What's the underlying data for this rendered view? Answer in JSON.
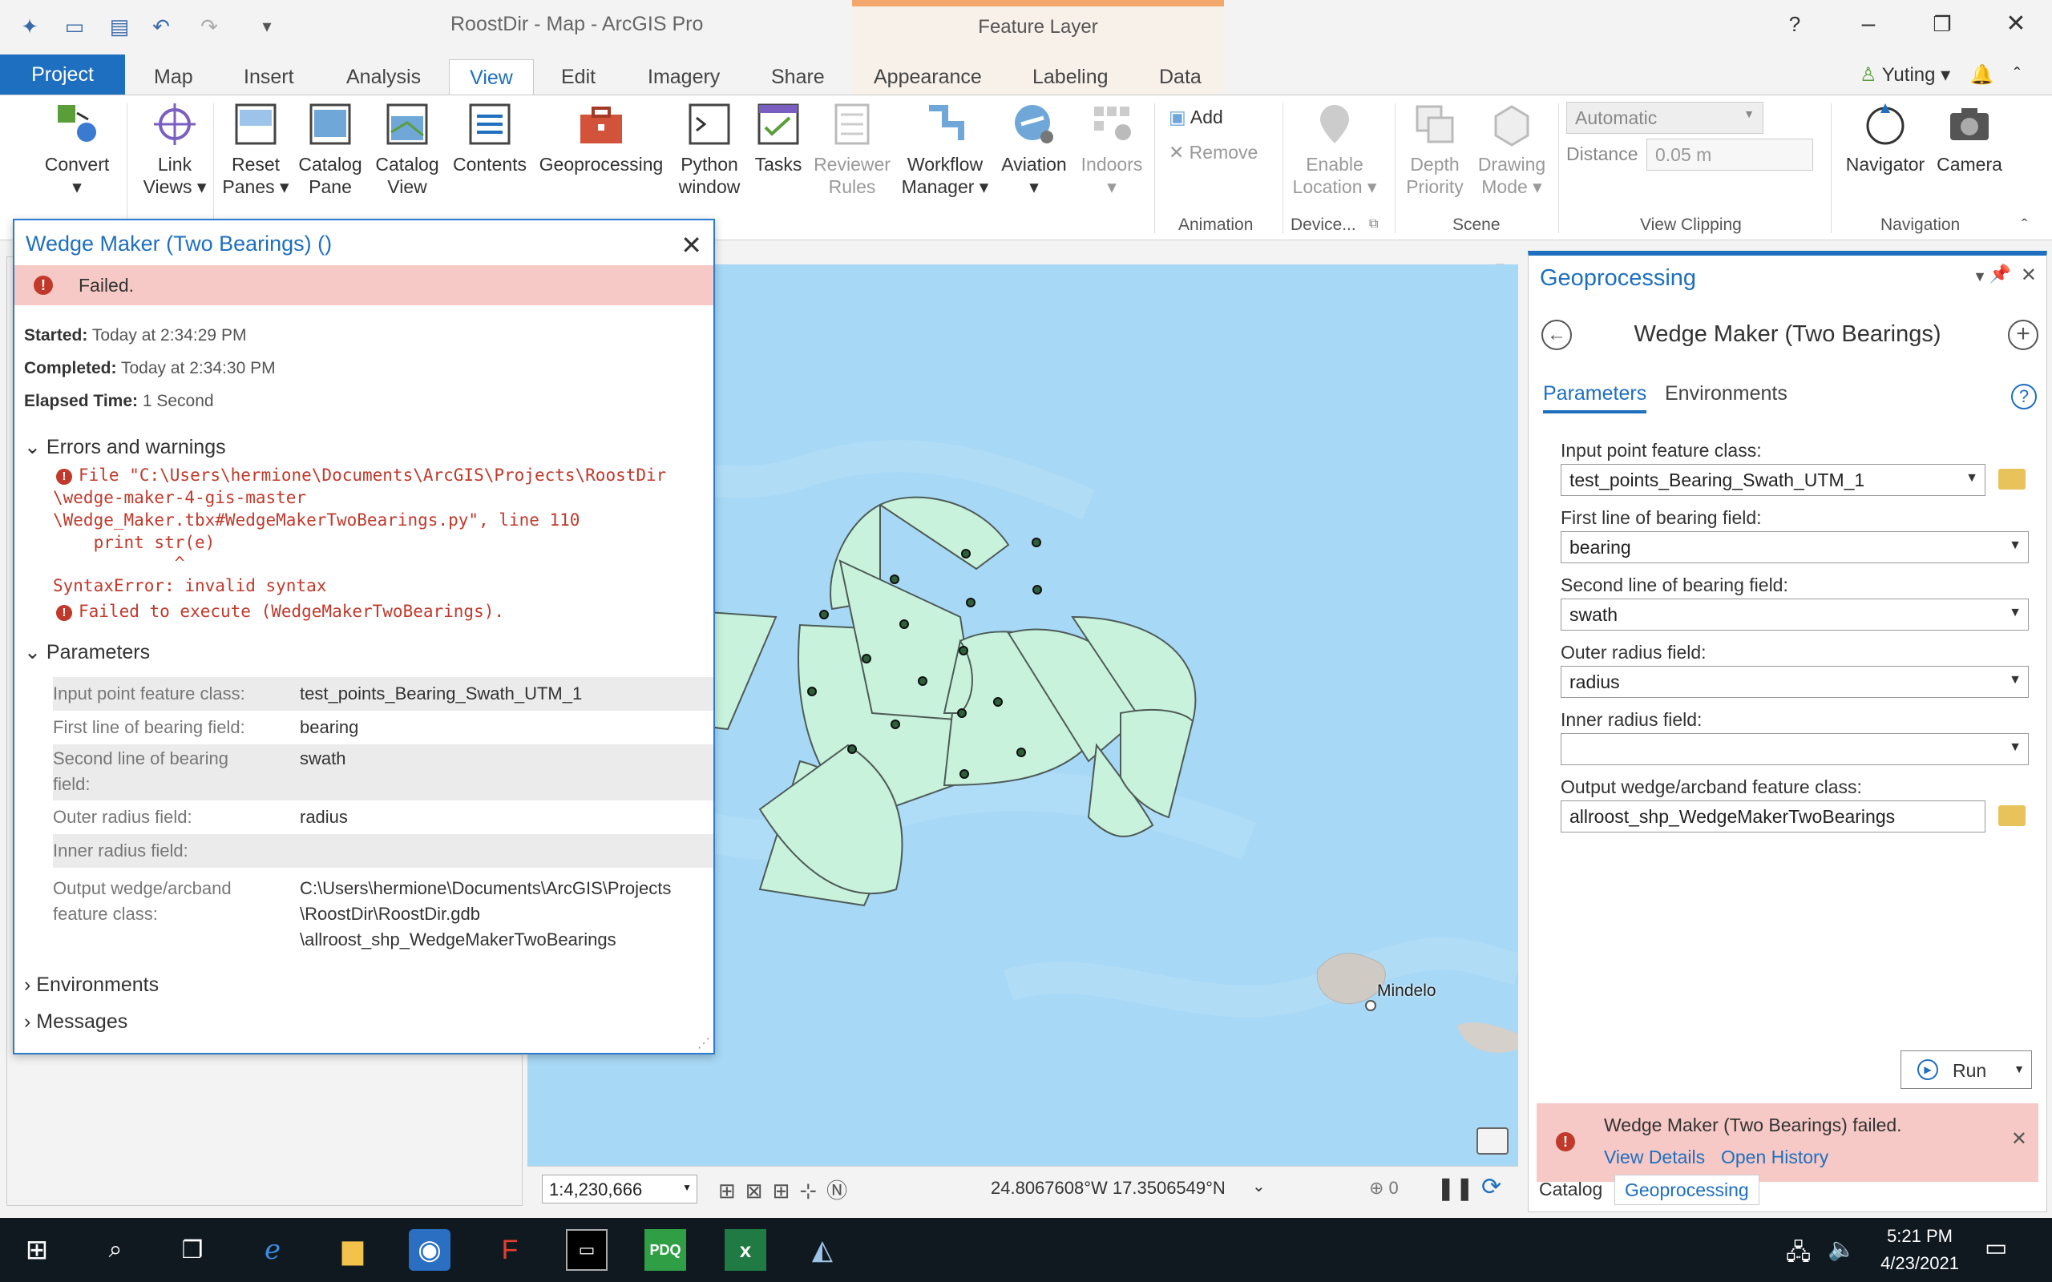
{
  "app": {
    "title": "RoostDir - Map - ArcGIS Pro",
    "context_title": "Feature Layer",
    "user": "Yuting",
    "help": "?"
  },
  "tabs": [
    "Project",
    "Map",
    "Insert",
    "Analysis",
    "View",
    "Edit",
    "Imagery",
    "Share",
    "Appearance",
    "Labeling",
    "Data"
  ],
  "active_tab": "View",
  "ribbon": {
    "convert": "Convert",
    "link_views": [
      "Link",
      "Views"
    ],
    "reset_panes": [
      "Reset",
      "Panes"
    ],
    "catalog_pane": [
      "Catalog",
      "Pane"
    ],
    "catalog_view": [
      "Catalog",
      "View"
    ],
    "contents": "Contents",
    "geoprocessing": "Geoprocessing",
    "python_window": [
      "Python",
      "window"
    ],
    "tasks": "Tasks",
    "reviewer_rules": [
      "Reviewer",
      "Rules"
    ],
    "workflow_manager": [
      "Workflow",
      "Manager"
    ],
    "aviation": "Aviation",
    "indoors": "Indoors",
    "add": "Add",
    "remove": "Remove",
    "animation": "Animation",
    "enable_location": [
      "Enable",
      "Location"
    ],
    "device": "Device...",
    "depth_priority": [
      "Depth",
      "Priority"
    ],
    "drawing_mode": [
      "Drawing",
      "Mode"
    ],
    "scene": "Scene",
    "automatic": "Automatic",
    "distance_label": "Distance",
    "distance_value": "0.05  m",
    "view_clipping": "View Clipping",
    "navigator": "Navigator",
    "camera": "Camera",
    "navigation": "Navigation"
  },
  "dialog": {
    "title": "Wedge Maker (Two Bearings) ()",
    "status": "Failed.",
    "started_label": "Started:",
    "started": "Today at 2:34:29 PM",
    "completed_label": "Completed:",
    "completed": "Today at 2:34:30 PM",
    "elapsed_label": "Elapsed Time:",
    "elapsed": "1 Second",
    "errors_header": "Errors and warnings",
    "error_lines": [
      "File \"C:\\Users\\hermione\\Documents\\ArcGIS\\Projects\\RoostDir",
      "\\wedge-maker-4-gis-master",
      "\\Wedge_Maker.tbx#WedgeMakerTwoBearings.py\", line 110",
      "    print str(e)",
      "            ^",
      "SyntaxError: invalid syntax"
    ],
    "error_failed": "Failed to execute (WedgeMakerTwoBearings).",
    "params_header": "Parameters",
    "params": [
      {
        "k": "Input point feature class:",
        "v": "test_points_Bearing_Swath_UTM_1"
      },
      {
        "k": "First line of bearing field:",
        "v": "bearing"
      },
      {
        "k": "Second line of bearing field:",
        "v": "swath"
      },
      {
        "k": "Outer radius field:",
        "v": "radius"
      },
      {
        "k": "Inner radius field:",
        "v": ""
      },
      {
        "k": "Output wedge/arcband feature class:",
        "v": "C:\\Users\\hermione\\Documents\\ArcGIS\\Projects\n\\RoostDir\\RoostDir.gdb\n\\allroost_shp_WedgeMakerTwoBearings"
      }
    ],
    "environments": "Environments",
    "messages": "Messages"
  },
  "map": {
    "place_label": "Mindelo",
    "scale": "1:4,230,666",
    "coords": "24.8067608°W 17.3506549°N",
    "selected_count": "0"
  },
  "gp": {
    "pane_title": "Geoprocessing",
    "tool_title": "Wedge Maker (Two Bearings)",
    "tab_parameters": "Parameters",
    "tab_environments": "Environments",
    "fields": [
      {
        "label": "Input point feature class:",
        "value": "test_points_Bearing_Swath_UTM_1"
      },
      {
        "label": "First line of bearing field:",
        "value": "bearing"
      },
      {
        "label": "Second line of bearing field:",
        "value": "swath"
      },
      {
        "label": "Outer radius field:",
        "value": "radius"
      },
      {
        "label": "Inner radius field:",
        "value": ""
      },
      {
        "label": "Output wedge/arcband feature class:",
        "value": "allroost_shp_WedgeMakerTwoBearings"
      }
    ],
    "run": "Run",
    "failed_msg": "Wedge Maker (Two Bearings) failed.",
    "view_details": "View Details",
    "open_history": "Open History"
  },
  "bottom_tabs": [
    "Catalog",
    "Geoprocessing"
  ],
  "taskbar": {
    "time": "5:21 PM",
    "date": "4/23/2021"
  }
}
